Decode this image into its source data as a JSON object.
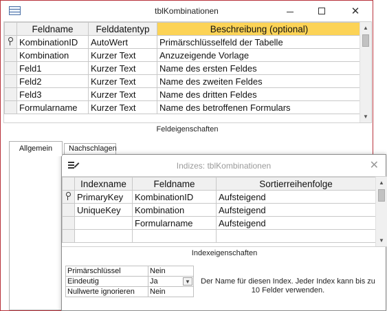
{
  "main_window": {
    "title": "tblKombinationen",
    "close_glyph": "✕"
  },
  "field_grid": {
    "columns": [
      "Feldname",
      "Felddatentyp",
      "Beschreibung (optional)"
    ],
    "rows": [
      {
        "key": true,
        "name": "KombinationID",
        "type": "AutoWert",
        "desc": "Primärschlüsselfeld der Tabelle"
      },
      {
        "key": false,
        "name": "Kombination",
        "type": "Kurzer Text",
        "desc": "Anzuzeigende Vorlage"
      },
      {
        "key": false,
        "name": "Feld1",
        "type": "Kurzer Text",
        "desc": "Name des ersten Feldes"
      },
      {
        "key": false,
        "name": "Feld2",
        "type": "Kurzer Text",
        "desc": "Name des zweiten Feldes"
      },
      {
        "key": false,
        "name": "Feld3",
        "type": "Kurzer Text",
        "desc": "Name des dritten Feldes"
      },
      {
        "key": false,
        "name": "Formularname",
        "type": "Kurzer Text",
        "desc": "Name des betroffenen Formulars"
      }
    ]
  },
  "field_properties": {
    "label": "Feldeigenschaften",
    "tabs": [
      "Allgemein",
      "Nachschlagen"
    ]
  },
  "index_dialog": {
    "title": "Indizes: tblKombinationen",
    "close_glyph": "✕",
    "columns": [
      "Indexname",
      "Feldname",
      "Sortierreihenfolge"
    ],
    "rows": [
      {
        "key": true,
        "index": "PrimaryKey",
        "field": "KombinationID",
        "order": "Aufsteigend"
      },
      {
        "key": false,
        "index": "UniqueKey",
        "field": "Kombination",
        "order": "Aufsteigend"
      },
      {
        "key": false,
        "index": "",
        "field": "Formularname",
        "order": "Aufsteigend"
      }
    ],
    "props_label": "Indexeigenschaften",
    "props": [
      {
        "name": "Primärschlüssel",
        "value": "Nein"
      },
      {
        "name": "Eindeutig",
        "value": "Ja"
      },
      {
        "name": "Nullwerte ignorieren",
        "value": "Nein"
      }
    ],
    "help_text": "Der Name für diesen Index. Jeder Index kann bis zu 10 Felder verwenden."
  },
  "colors": {
    "active_header": "#fcd356",
    "window_border": "#b7313a"
  }
}
